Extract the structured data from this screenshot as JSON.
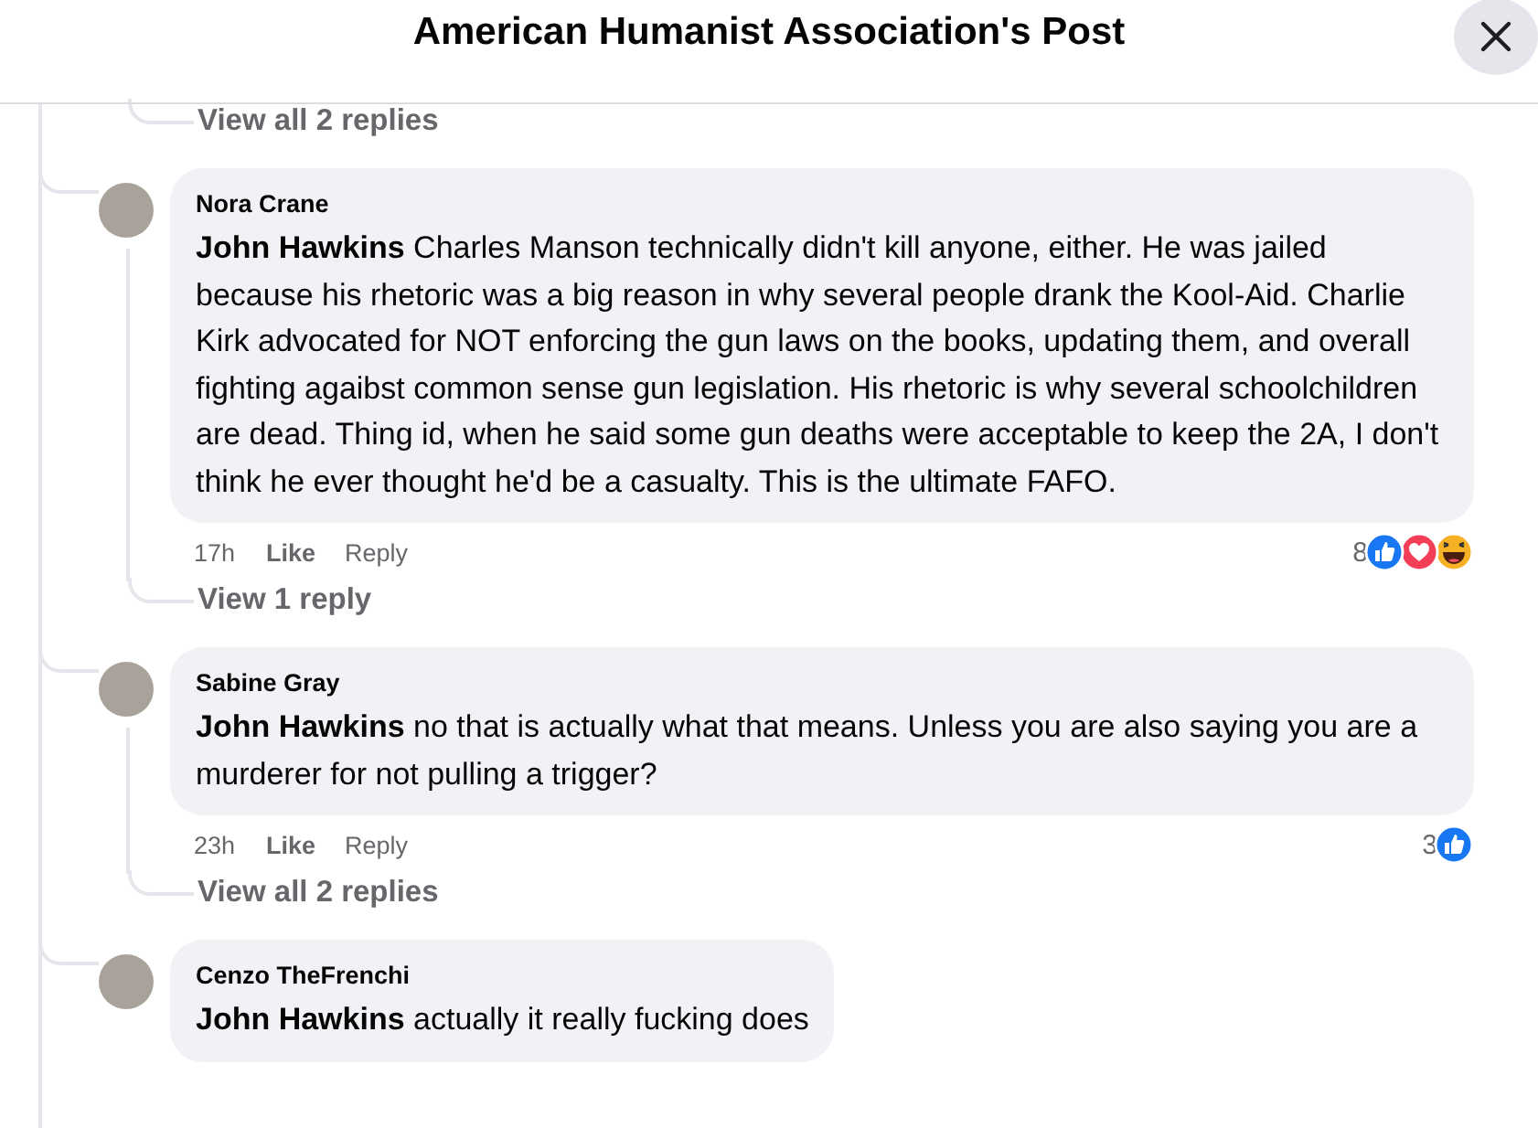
{
  "header": {
    "title": "American Humanist Association's Post"
  },
  "previous_thread": {
    "replies_link": "View all 2 replies"
  },
  "comments": [
    {
      "author": "Nora Crane",
      "mention": "John Hawkins",
      "text": "Charles Manson technically didn't kill anyone, either. He was jailed because his rhetoric was a big reason in why several people drank the Kool-Aid. Charlie Kirk advocated for NOT enforcing the gun laws on the books, updating them, and overall fighting agaibst common sense gun legislation. His rhetoric is why several schoolchildren are dead. Thing id, when he said some gun deaths were acceptable to keep the 2A, I don't think he ever thought he'd be a casualty. This is the ultimate FAFO.",
      "time": "17h",
      "like": "Like",
      "reply": "Reply",
      "reaction_count": "8",
      "reactions": [
        {
          "kind": "like"
        },
        {
          "kind": "love"
        },
        {
          "kind": "haha"
        }
      ],
      "replies_link": "View 1 reply"
    },
    {
      "author": "Sabine Gray",
      "mention": "John Hawkins",
      "text": "no that is actually what that means. Unless you are also saying you are a murderer for not pulling a trigger?",
      "time": "23h",
      "like": "Like",
      "reply": "Reply",
      "reaction_count": "3",
      "reactions": [
        {
          "kind": "like"
        }
      ],
      "replies_link": "View all 2 replies"
    },
    {
      "author": "Cenzo TheFrenchi",
      "mention": "John Hawkins",
      "text": "actually it really fucking does"
    }
  ]
}
